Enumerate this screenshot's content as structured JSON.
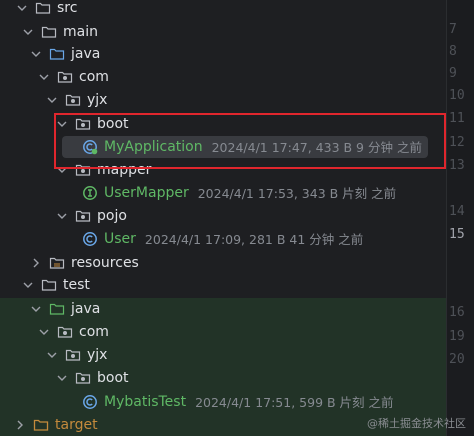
{
  "tree": {
    "rows": [
      {
        "label": "src"
      },
      {
        "label": "main"
      },
      {
        "label": "java"
      },
      {
        "label": "com"
      },
      {
        "label": "yjx"
      },
      {
        "label": "boot"
      },
      {
        "label": "MyApplication",
        "meta": "2024/4/1 17:47, 433 B 9 分钟 之前"
      },
      {
        "label": "mapper"
      },
      {
        "label": "UserMapper",
        "meta": "2024/4/1 17:53, 343 B 片刻 之前"
      },
      {
        "label": "pojo"
      },
      {
        "label": "User",
        "meta": "2024/4/1 17:09, 281 B 41 分钟 之前"
      },
      {
        "label": "resources"
      },
      {
        "label": "test"
      },
      {
        "label": "java"
      },
      {
        "label": "com"
      },
      {
        "label": "yjx"
      },
      {
        "label": "boot"
      },
      {
        "label": "MybatisTest",
        "meta": "2024/4/1 17:51, 599 B 片刻 之前"
      },
      {
        "label": "target"
      }
    ]
  },
  "gutter": {
    "lines": [
      "7",
      "8",
      "9",
      "10",
      "11",
      "12",
      "13",
      "14",
      "15",
      "16",
      "19",
      "20"
    ]
  },
  "watermark": "@稀土掘金技术社区",
  "colors": {
    "background": "#1e1f22",
    "test_band": "#223327",
    "selection": "#393b40",
    "highlight_box": "#e0262d",
    "class_green": "#5fb865",
    "folder_orange": "#c48a3c"
  }
}
